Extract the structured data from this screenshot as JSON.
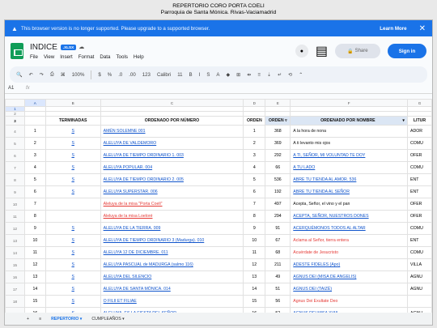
{
  "page": {
    "title": "REPERTORIO CORO PORTA COELI",
    "subtitle": "Parroquia de Santa Mónica. Rivas-Vaciamadrid"
  },
  "banner": {
    "message": "This browser version is no longer supported. Please upgrade to a supported browser.",
    "learn_more": "Learn More",
    "close": "✕"
  },
  "doc": {
    "name": "INDICE",
    "badge": ".XLSX",
    "menus": [
      "File",
      "View",
      "Insert",
      "Format",
      "Data",
      "Tools",
      "Help"
    ],
    "share": "Share",
    "signin": "Sign in"
  },
  "toolbar": {
    "zoom": "100%",
    "currency": "$",
    "percent": "%",
    "decimal_less": ".0",
    "decimal_more": ".00",
    "number": "123",
    "font": "Calibri",
    "size": "11",
    "bold": "B",
    "italic": "I",
    "strike": "S",
    "text_color": "A"
  },
  "formula": {
    "cell": "A1",
    "fx": "fx",
    "value": ""
  },
  "columns": [
    "A",
    "B",
    "C",
    "D",
    "E",
    "F",
    "G"
  ],
  "headers": [
    "TERMINADAS",
    "ORDENADO POR NÚMERO",
    "ORDEN",
    "ORDEN",
    "ORDENADO POR NOMBRE",
    "LITUR"
  ],
  "rows": [
    {
      "rn": "4",
      "n": "1",
      "s": "S",
      "title": "AMÉN SOLEMNE 001",
      "order": "1",
      "order2": "368",
      "name": "A la hora de nona",
      "lit": "ADOR",
      "tstyle": "link",
      "nstyle": "dark"
    },
    {
      "rn": "5",
      "n": "2",
      "s": "S",
      "title": "ALELUYA DE VALDEMORO",
      "order": "2",
      "order2": "369",
      "name": "A ti levanto mis ojos",
      "lit": "COMU",
      "tstyle": "link",
      "nstyle": "dark"
    },
    {
      "rn": "6",
      "n": "3",
      "s": "S",
      "title": "ALELUYA DE TIEMPO ORDINARIO 1. 003",
      "order": "3",
      "order2": "292",
      "name": "A TI, SEÑOR, MI VOLUNTAD TE DOY",
      "lit": "OFER",
      "tstyle": "link",
      "nstyle": "link"
    },
    {
      "rn": "7",
      "n": "4",
      "s": "S",
      "title": "ALELUYA POPULAR. 004",
      "order": "4",
      "order2": "66",
      "name": "A TU LADO",
      "lit": "COMU",
      "tstyle": "link",
      "nstyle": "link"
    },
    {
      "rn": "8",
      "n": "5",
      "s": "S",
      "title": "ALELUYA DE TIEMPO ORDINARIO 2. 005",
      "order": "5",
      "order2": "536",
      "name": "ABRE TU TIENDA AL AMOR. 536",
      "lit": "ENT",
      "tstyle": "link",
      "nstyle": "link"
    },
    {
      "rn": "9",
      "n": "6",
      "s": "S",
      "title": "ALELUYA SUPERSTAR. 006",
      "order": "6",
      "order2": "192",
      "name": "ABRE TU TIENDA AL SEÑOR",
      "lit": "ENT",
      "tstyle": "link",
      "nstyle": "link"
    },
    {
      "rn": "10",
      "n": "7",
      "s": "",
      "title": "Aleluya de la misa \"Porta Coeli\"",
      "order": "7",
      "order2": "497",
      "name": "Acepta, Señor, el vino y el pan",
      "lit": "OFER",
      "tstyle": "red",
      "nstyle": "dark"
    },
    {
      "rn": "11",
      "n": "8",
      "s": "",
      "title": "Aleluya de la misa Loeloré",
      "order": "8",
      "order2": "294",
      "name": "ACEPTA, SEÑOR, NUESTROS DONES",
      "lit": "OFER",
      "tstyle": "red",
      "nstyle": "link"
    },
    {
      "rn": "12",
      "n": "9",
      "s": "S",
      "title": "ALELUYA DE LA TIERRA. 009",
      "order": "9",
      "order2": "91",
      "name": "ACERQUÉMONOS TODOS AL ALTAR",
      "lit": "COMU",
      "tstyle": "link",
      "nstyle": "link"
    },
    {
      "rn": "13",
      "n": "10",
      "s": "S",
      "title": "ALELUYA DE TIEMPO ORDINARIO 3 (Madurga). 010",
      "order": "10",
      "order2": "67",
      "name": "Aclama al Señor, tierra entera",
      "lit": "ENT",
      "tstyle": "link",
      "nstyle": "redtext"
    },
    {
      "rn": "14",
      "n": "11",
      "s": "S",
      "title": "ALELUYA 12 DE DICIEMBRE. 011",
      "order": "11",
      "order2": "68",
      "name": "Acuérdate de Jesucristo",
      "lit": "COMU",
      "tstyle": "link",
      "nstyle": "redtext"
    },
    {
      "rn": "15",
      "n": "12",
      "s": "S",
      "title": "ALELUYA PASCUAL de MADURGA (salmo 116)",
      "order": "12",
      "order2": "211",
      "name": "ADESTE FIDELES (Apo)",
      "lit": "VILLA",
      "tstyle": "link",
      "nstyle": "link"
    },
    {
      "rn": "16",
      "n": "13",
      "s": "S",
      "title": "ALELUYA DEL SILENCIO",
      "order": "13",
      "order2": "49",
      "name": "AGNUS DEI (MISA DE ANGELIS)",
      "lit": "AGNU",
      "tstyle": "link",
      "nstyle": "link"
    },
    {
      "rn": "17",
      "n": "14",
      "s": "S",
      "title": "ALELUYA DE SANTA MÓNICA. 014",
      "order": "14",
      "order2": "51",
      "name": "AGNUS DEI (TAIZÉ)",
      "lit": "AGNU",
      "tstyle": "link",
      "nstyle": "link"
    },
    {
      "rn": "18",
      "n": "15",
      "s": "S",
      "title": "O FILII ET FILIAE",
      "order": "15",
      "order2": "56",
      "name": "Agnus Dei Exultate Deo",
      "lit": "",
      "tstyle": "link",
      "nstyle": "redtext"
    },
    {
      "rn": "19",
      "n": "16",
      "s": "S",
      "title": "ALELUYA, ES LA FIESTA DEL SEÑOR",
      "order": "16",
      "order2": "52",
      "name": "AGNUS DEI MISA XVIII",
      "lit": "AGNU",
      "tstyle": "link",
      "nstyle": "link"
    }
  ],
  "sheets": [
    "REPERTORIO",
    "CUMPLEAÑOS"
  ],
  "icons": {
    "add": "+",
    "menu": "≡",
    "warning": "▲"
  }
}
